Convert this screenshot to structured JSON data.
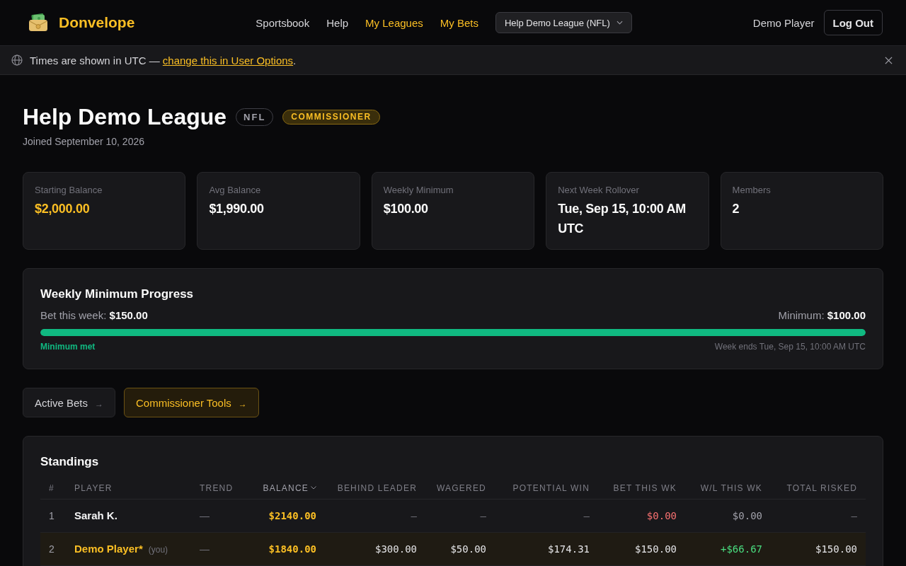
{
  "header": {
    "brand": "Donvelope",
    "nav": [
      {
        "label": "Sportsbook",
        "color": "#d4d4d8"
      },
      {
        "label": "Help",
        "color": "#d4d4d8"
      },
      {
        "label": "My Leagues",
        "color": "#fbbf24"
      },
      {
        "label": "My Bets",
        "color": "#fbbf24"
      }
    ],
    "league_select": {
      "value": "Help Demo League (NFL)"
    },
    "user": "Demo Player",
    "logout": "Log Out"
  },
  "banner": {
    "text": "Times are shown in UTC — ",
    "link": "change this in User Options",
    "suffix": "."
  },
  "league": {
    "title": "Help Demo League",
    "badges": [
      {
        "label": "NFL",
        "kind": "sport"
      },
      {
        "label": "COMMISSIONER",
        "kind": "role"
      }
    ],
    "joined": "Joined September 10, 2026"
  },
  "stats": [
    {
      "label": "Starting Balance",
      "value": "$2,000.00",
      "color": "#fbbf24"
    },
    {
      "label": "Avg Balance",
      "value": "$1,990.00",
      "color": "#fafafa"
    },
    {
      "label": "Weekly Minimum",
      "value": "$100.00",
      "color": "#fafafa"
    },
    {
      "label": "Next Week Rollover",
      "value": "Tue, Sep 15, 10:00 AM UTC",
      "color": "#fafafa"
    },
    {
      "label": "Members",
      "value": "2",
      "color": "#fafafa"
    }
  ],
  "progress": {
    "title": "Weekly Minimum Progress",
    "bet": "Bet this week: **$150.00**",
    "minimum": "Minimum: **$100.00**",
    "level": 1,
    "met": true,
    "status": "Minimum met",
    "note": "Week ends Tue, Sep 15, 10:00 AM UTC"
  },
  "actions": [
    {
      "label": "Active Bets",
      "arrow": "→",
      "kind": "default"
    },
    {
      "label": "Commissioner Tools",
      "arrow": "→",
      "kind": "accent"
    }
  ],
  "standings": {
    "title": "Standings",
    "columns": [
      {
        "label": "#",
        "sorted": false
      },
      {
        "label": "PLAYER",
        "sorted": false
      },
      {
        "label": "TREND",
        "sorted": false
      },
      {
        "label": "BALANCE",
        "sorted": true
      },
      {
        "label": "BEHIND LEADER",
        "sorted": false
      },
      {
        "label": "WAGERED",
        "sorted": false
      },
      {
        "label": "POTENTIAL WIN",
        "sorted": false
      },
      {
        "label": "BET THIS WK",
        "sorted": false
      },
      {
        "label": "W/L THIS WK",
        "sorted": false
      },
      {
        "label": "TOTAL RISKED",
        "sorted": false
      }
    ],
    "rows": [
      {
        "current_user": false,
        "cells": [
          {
            "text": "1"
          },
          {
            "text": "Sarah K."
          },
          {
            "text": "—",
            "color": "#71717a"
          },
          {
            "text": "$2140.00",
            "color": "#fbbf24"
          },
          {
            "text": "—",
            "color": "#71717a"
          },
          {
            "text": "—",
            "color": "#71717a"
          },
          {
            "text": "—",
            "color": "#71717a"
          },
          {
            "text": "$0.00",
            "color": "#f87171"
          },
          {
            "text": "$0.00",
            "color": "#a1a1aa"
          },
          {
            "text": "—",
            "color": "#71717a"
          }
        ]
      },
      {
        "current_user": true,
        "cells": [
          {
            "text": "2"
          },
          {
            "text": "Demo Player*",
            "note": "(you)"
          },
          {
            "text": "—",
            "color": "#71717a"
          },
          {
            "text": "$1840.00",
            "color": "#fbbf24"
          },
          {
            "text": "$300.00",
            "color": "#e4e4e7"
          },
          {
            "text": "$50.00",
            "color": "#e4e4e7"
          },
          {
            "text": "$174.31",
            "color": "#e4e4e7"
          },
          {
            "text": "$150.00",
            "color": "#e4e4e7"
          },
          {
            "text": "+$66.67",
            "color": "#4ade80"
          },
          {
            "text": "$150.00",
            "color": "#e4e4e7"
          }
        ]
      }
    ]
  }
}
